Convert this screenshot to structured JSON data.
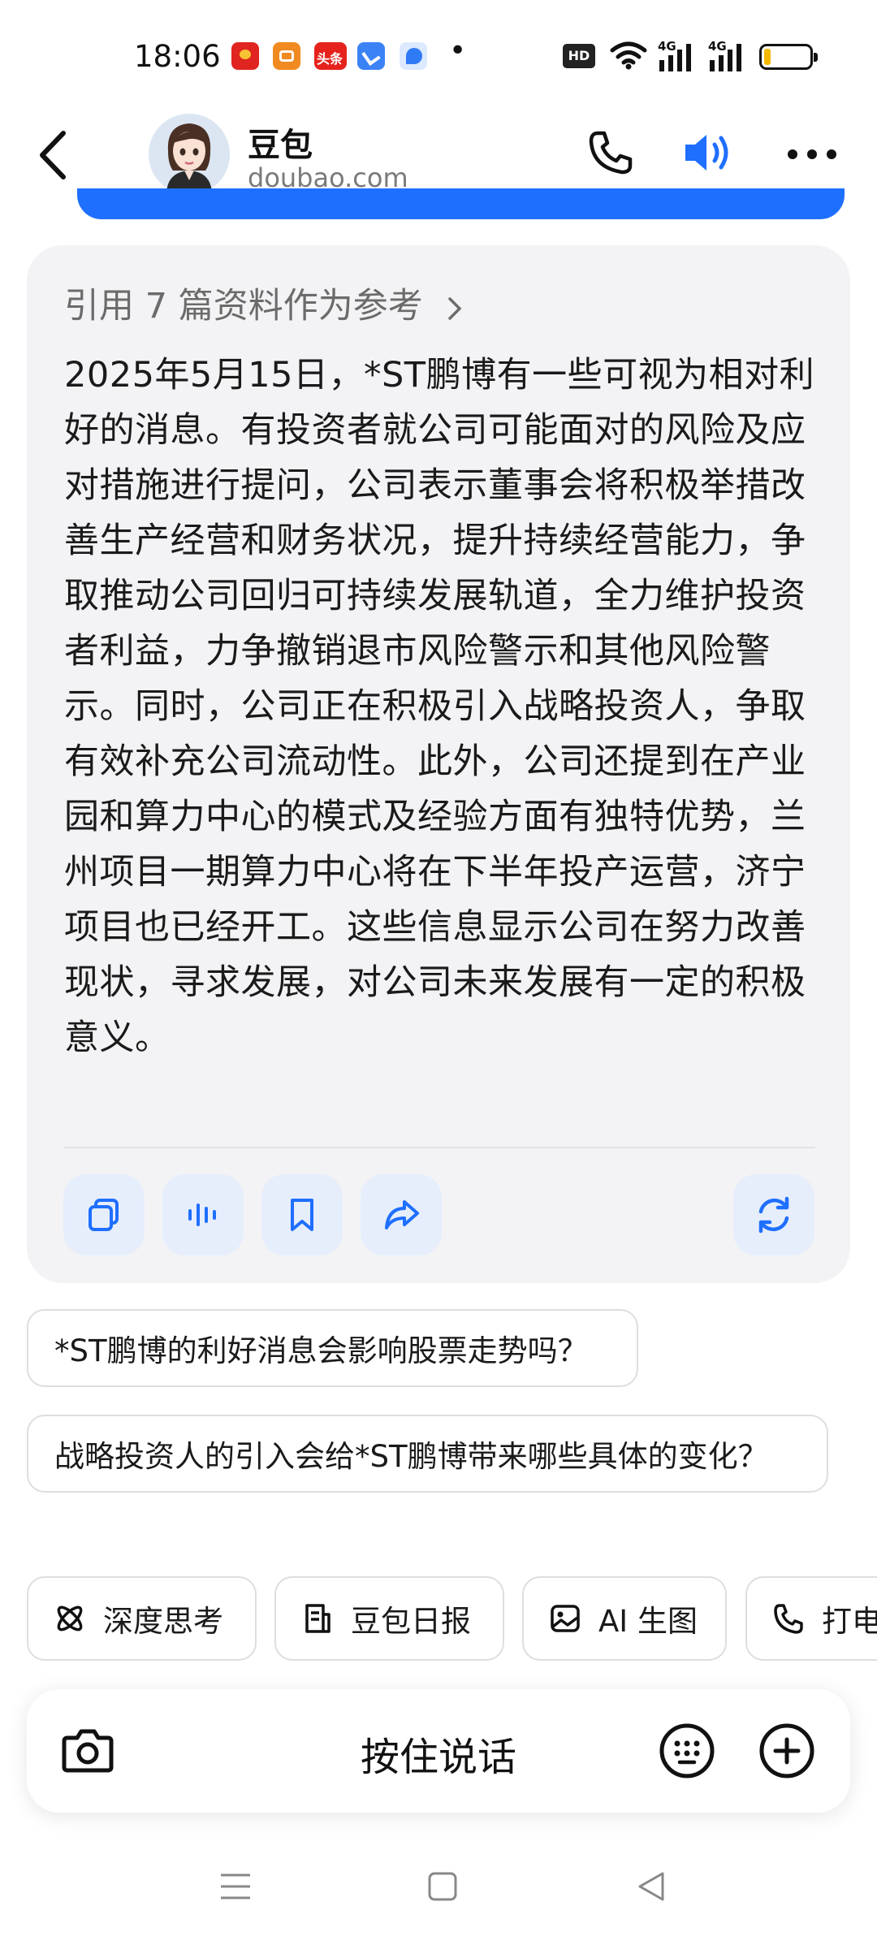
{
  "status_bar": {
    "time": "18:06",
    "app_icons": [
      "red-envelope-icon",
      "orange-app-icon",
      "toutiao-icon",
      "blue-app-icon",
      "light-blue-app-icon"
    ],
    "toutiao_label": "头条",
    "dot": "•",
    "hd_label": "HD",
    "net_label_1": "4G",
    "net_label_2": "4G",
    "battery_level": 0.15
  },
  "header": {
    "name": "豆包",
    "subtitle": "doubao.com"
  },
  "answer": {
    "reference_text": "引用 7 篇资料作为参考",
    "body": "2025年5月15日，*ST鹏博有一些可视为相对利好的消息。有投资者就公司可能面对的风险及应对措施进行提问，公司表示董事会将积极举措改善生产经营和财务状况，提升持续经营能力，争取推动公司回归可持续发展轨道，全力维护投资者利益，力争撤销退市风险警示和其他风险警示。同时，公司正在积极引入战略投资人，争取有效补充公司流动性。此外，公司还提到在产业园和算力中心的模式及经验方面有独特优势，兰州项目一期算力中心将在下半年投产运营，济宁项目也已经开工。这些信息显示公司在努力改善现状，寻求发展，对公司未来发展有一定的积极意义。"
  },
  "suggestions": [
    "*ST鹏博的利好消息会影响股票走势吗？",
    "战略投资人的引入会给*ST鹏博带来哪些具体的变化？"
  ],
  "tools": [
    {
      "label": "深度思考"
    },
    {
      "label": "豆包日报"
    },
    {
      "label": "AI 生图"
    },
    {
      "label": "打电"
    }
  ],
  "input_bar": {
    "hold_to_talk": "按住说话"
  },
  "colors": {
    "accent": "#1f6fff",
    "card_bg": "#f3f3f5",
    "action_bg": "#e6eefc"
  }
}
